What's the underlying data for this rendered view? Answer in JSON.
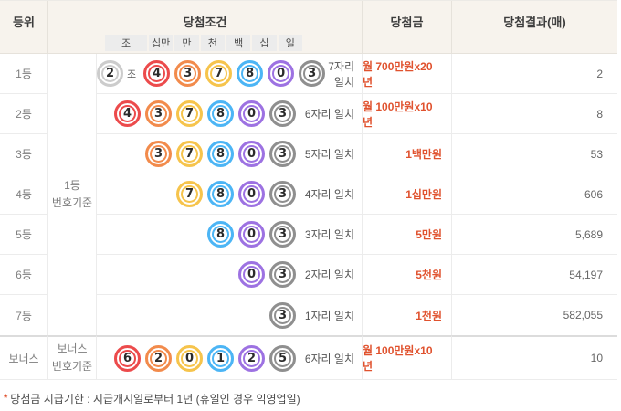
{
  "colors": {
    "header_bg": "#f7f3ed",
    "prize_text": "#e0522e",
    "ball_colors": {
      "jo": "#cccccc",
      "sipman": "#ec4b4c",
      "man": "#f28b4c",
      "cheon": "#f6c44c",
      "baek": "#4cb5f5",
      "sip": "#9d72e2",
      "il": "#8f8f8f"
    }
  },
  "header": {
    "rank": "등위",
    "condition": "당첨조건",
    "prize": "당첨금",
    "result": "당첨결과(매)",
    "digit_labels": [
      "조",
      "십만",
      "만",
      "천",
      "백",
      "십",
      "일"
    ]
  },
  "basis": {
    "first": [
      "1등",
      "번호기준"
    ],
    "bonus": [
      "보너스",
      "번호기준"
    ]
  },
  "rows": [
    {
      "rank": "1등",
      "jo": "2",
      "jo_suffix": "조",
      "balls": [
        [
          "4",
          "sipman"
        ],
        [
          "3",
          "man"
        ],
        [
          "7",
          "cheon"
        ],
        [
          "8",
          "baek"
        ],
        [
          "0",
          "sip"
        ],
        [
          "3",
          "il"
        ]
      ],
      "match": "7자리 일치",
      "prize": "월 700만원x20년",
      "result": "2"
    },
    {
      "rank": "2등",
      "balls": [
        [
          "4",
          "sipman"
        ],
        [
          "3",
          "man"
        ],
        [
          "7",
          "cheon"
        ],
        [
          "8",
          "baek"
        ],
        [
          "0",
          "sip"
        ],
        [
          "3",
          "il"
        ]
      ],
      "match": "6자리 일치",
      "prize": "월 100만원x10년",
      "result": "8"
    },
    {
      "rank": "3등",
      "balls": [
        [
          "3",
          "man"
        ],
        [
          "7",
          "cheon"
        ],
        [
          "8",
          "baek"
        ],
        [
          "0",
          "sip"
        ],
        [
          "3",
          "il"
        ]
      ],
      "match": "5자리 일치",
      "prize": "1백만원",
      "result": "53"
    },
    {
      "rank": "4등",
      "balls": [
        [
          "7",
          "cheon"
        ],
        [
          "8",
          "baek"
        ],
        [
          "0",
          "sip"
        ],
        [
          "3",
          "il"
        ]
      ],
      "match": "4자리 일치",
      "prize": "1십만원",
      "result": "606"
    },
    {
      "rank": "5등",
      "balls": [
        [
          "8",
          "baek"
        ],
        [
          "0",
          "sip"
        ],
        [
          "3",
          "il"
        ]
      ],
      "match": "3자리 일치",
      "prize": "5만원",
      "result": "5,689"
    },
    {
      "rank": "6등",
      "balls": [
        [
          "0",
          "sip"
        ],
        [
          "3",
          "il"
        ]
      ],
      "match": "2자리 일치",
      "prize": "5천원",
      "result": "54,197"
    },
    {
      "rank": "7등",
      "balls": [
        [
          "3",
          "il"
        ]
      ],
      "match": "1자리 일치",
      "prize": "1천원",
      "result": "582,055"
    },
    {
      "rank": "보너스",
      "bonus": true,
      "balls": [
        [
          "6",
          "sipman"
        ],
        [
          "2",
          "man"
        ],
        [
          "0",
          "cheon"
        ],
        [
          "1",
          "baek"
        ],
        [
          "2",
          "sip"
        ],
        [
          "5",
          "il"
        ]
      ],
      "match": "6자리 일치",
      "prize": "월 100만원x10년",
      "result": "10"
    }
  ],
  "footnote": {
    "marker": "*",
    "text": "당첨금 지급기한 : 지급개시일로부터 1년 (휴일인 경우 익영업일)"
  }
}
